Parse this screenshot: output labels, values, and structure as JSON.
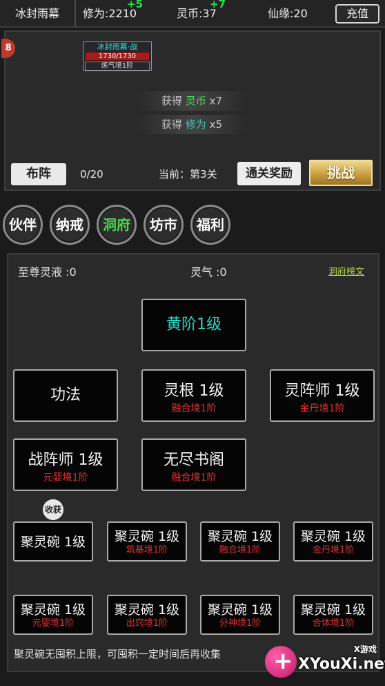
{
  "topbar": {
    "player_name": "冰封雨幕",
    "cultivation_label": "修为:2210",
    "cultivation_gain": "+5",
    "spirit_coin_label": "灵币:37",
    "spirit_coin_gain": "+7",
    "fate_label": "仙缘:20",
    "recharge": "充值"
  },
  "battle": {
    "edge_badge": "8",
    "character": {
      "name": "冰封雨幕·战",
      "hp": "1730/1730",
      "hp_fraction": 1.0,
      "realm": "炼气境1阶"
    },
    "gains": [
      {
        "prefix": "获得",
        "resource": "灵币",
        "amount": "x7"
      },
      {
        "prefix": "获得",
        "resource": "修为",
        "amount": "x5"
      }
    ],
    "formation_btn": "布阵",
    "count": "0/20",
    "current_stage": "当前：第3关",
    "reward_btn": "通关奖励",
    "challenge_btn": "挑战"
  },
  "tabs": [
    {
      "label": "伙伴",
      "active": false
    },
    {
      "label": "纳戒",
      "active": false
    },
    {
      "label": "洞府",
      "active": true
    },
    {
      "label": "坊市",
      "active": false
    },
    {
      "label": "福利",
      "active": false
    }
  ],
  "cave": {
    "supreme_liquid": "至尊灵液 :0",
    "spirit_qi": "灵气 :0",
    "link": "洞府榜文",
    "level": "黄阶1级",
    "buildings": [
      {
        "title": "功法",
        "req": ""
      },
      {
        "title": "灵根 1级",
        "req": "融合境1阶"
      },
      {
        "title": "灵阵师 1级",
        "req": "金丹境1阶"
      },
      {
        "title": "战阵师 1级",
        "req": "元婴境1阶"
      },
      {
        "title": "无尽书阁",
        "req": "融合境1阶"
      }
    ],
    "harvest": "收获",
    "bowls": [
      {
        "title": "聚灵碗 1级",
        "req": ""
      },
      {
        "title": "聚灵碗 1级",
        "req": "筑基境1阶"
      },
      {
        "title": "聚灵碗 1级",
        "req": "融合境1阶"
      },
      {
        "title": "聚灵碗 1级",
        "req": "金丹境1阶"
      },
      {
        "title": "聚灵碗 1级",
        "req": "元婴境1阶"
      },
      {
        "title": "聚灵碗 1级",
        "req": "出窍境1阶"
      },
      {
        "title": "聚灵碗 1级",
        "req": "分神境1阶"
      },
      {
        "title": "聚灵碗 1级",
        "req": "合体境1阶"
      }
    ],
    "note": "聚灵碗无囤积上限，可囤积一定时间后再收集"
  },
  "watermark": {
    "site": "XYouXi.net",
    "tag": "X游戏"
  },
  "colors": {
    "active_tab": "#45d94a",
    "requirement": "#e23333",
    "level_text": "#2fd5c3",
    "gain_green": "#22e24a"
  }
}
